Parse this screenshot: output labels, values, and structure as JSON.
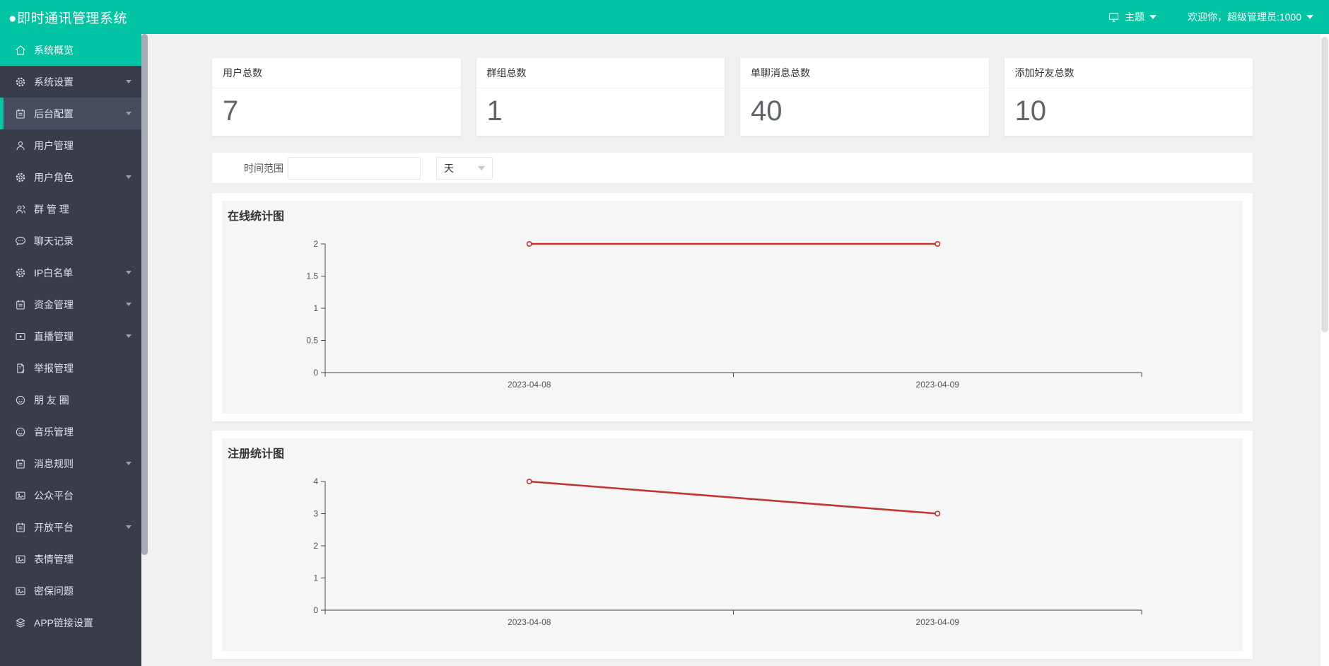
{
  "header": {
    "app_title": "●即时通讯管理系统",
    "theme_label": "主题",
    "welcome_text": "欢迎你，超级管理员:1000"
  },
  "sidebar": {
    "items": [
      {
        "label": "系统概览",
        "icon": "home-icon",
        "state": "active",
        "expandable": false
      },
      {
        "label": "系统设置",
        "icon": "gear-icon",
        "state": "normal",
        "expandable": true
      },
      {
        "label": "后台配置",
        "icon": "notebook-icon",
        "state": "highlighted",
        "expandable": true
      },
      {
        "label": "用户管理",
        "icon": "user-icon",
        "state": "normal",
        "expandable": false
      },
      {
        "label": "用户角色",
        "icon": "gear-icon",
        "state": "normal",
        "expandable": true
      },
      {
        "label": "群 管 理",
        "icon": "users-icon",
        "state": "normal",
        "expandable": false
      },
      {
        "label": "聊天记录",
        "icon": "chat-icon",
        "state": "normal",
        "expandable": false
      },
      {
        "label": "IP白名单",
        "icon": "gear-icon",
        "state": "normal",
        "expandable": true
      },
      {
        "label": "资金管理",
        "icon": "notebook-icon",
        "state": "normal",
        "expandable": true
      },
      {
        "label": "直播管理",
        "icon": "video-icon",
        "state": "normal",
        "expandable": true
      },
      {
        "label": "举报管理",
        "icon": "report-icon",
        "state": "normal",
        "expandable": false
      },
      {
        "label": "朋 友 圈",
        "icon": "smiley-icon",
        "state": "normal",
        "expandable": false
      },
      {
        "label": "音乐管理",
        "icon": "smiley-icon",
        "state": "normal",
        "expandable": false
      },
      {
        "label": "消息规则",
        "icon": "notebook-icon",
        "state": "normal",
        "expandable": true
      },
      {
        "label": "公众平台",
        "icon": "image-icon",
        "state": "normal",
        "expandable": false
      },
      {
        "label": "开放平台",
        "icon": "notebook-icon",
        "state": "normal",
        "expandable": true
      },
      {
        "label": "表情管理",
        "icon": "image-icon",
        "state": "normal",
        "expandable": false
      },
      {
        "label": "密保问题",
        "icon": "image-icon",
        "state": "normal",
        "expandable": false
      },
      {
        "label": "APP链接设置",
        "icon": "layers-icon",
        "state": "normal",
        "expandable": false
      }
    ]
  },
  "stats": [
    {
      "label": "用户总数",
      "value": "7"
    },
    {
      "label": "群组总数",
      "value": "1"
    },
    {
      "label": "单聊消息总数",
      "value": "40"
    },
    {
      "label": "添加好友总数",
      "value": "10"
    }
  ],
  "filter": {
    "label": "时间范围",
    "input_value": "",
    "select_value": "天"
  },
  "chart_data": [
    {
      "type": "line",
      "title": "在线统计图",
      "categories": [
        "2023-04-08",
        "2023-04-09"
      ],
      "values": [
        2,
        2
      ],
      "ylim": [
        0,
        2
      ],
      "yticks": [
        0,
        0.5,
        1,
        1.5,
        2
      ],
      "ytick_labels": [
        "0",
        "0.5",
        "1",
        "1.5",
        "2"
      ],
      "xlabel": "",
      "ylabel": "",
      "grid": false,
      "legend_position": "none",
      "line_color": "#c23531"
    },
    {
      "type": "line",
      "title": "注册统计图",
      "categories": [
        "2023-04-08",
        "2023-04-09"
      ],
      "values": [
        4,
        3
      ],
      "ylim": [
        0,
        4
      ],
      "yticks": [
        0,
        1,
        2,
        3,
        4
      ],
      "ytick_labels": [
        "0",
        "1",
        "2",
        "3",
        "4"
      ],
      "xlabel": "",
      "ylabel": "",
      "grid": false,
      "legend_position": "none",
      "line_color": "#c23531"
    }
  ],
  "colors": {
    "accent_teal": "#00c4a3",
    "sidebar_bg": "#393d49",
    "sidebar_highlight_bg": "#474c5e",
    "chart_line_red": "#c23531",
    "content_bg": "#f0f0f1",
    "chart_panel_bg": "#f6f6f7",
    "axis_color": "#444444",
    "tick_label_color": "#555555"
  }
}
